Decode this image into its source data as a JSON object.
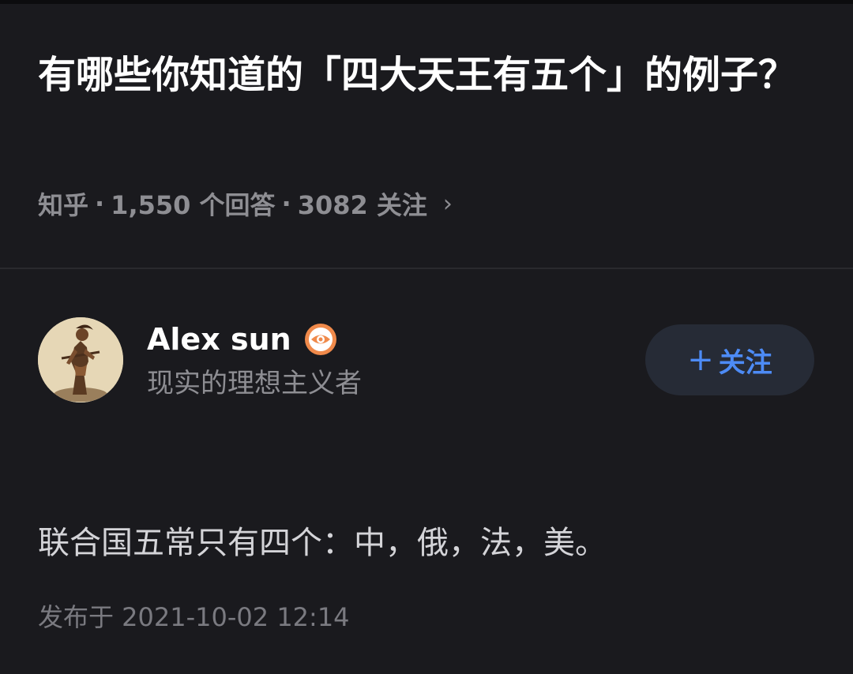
{
  "question": {
    "title": "有哪些你知道的「四大天王有五个」的例子？",
    "source": "知乎",
    "separator": "·",
    "answers": "1,550 个回答",
    "followers": "3082 关注",
    "chevron_icon": "chevron-right-icon"
  },
  "author": {
    "name": "Alex sun",
    "bio": "现实的理想主义者",
    "badge_icon": "eye-badge-icon",
    "avatar_icon": "warrior-avatar"
  },
  "follow_button": {
    "plus": "+",
    "label": "关注",
    "color": "#4d8bf5"
  },
  "answer": {
    "content": "联合国五常只有四个：中，俄，法，美。",
    "published": "发布于 2021-10-02 12:14"
  },
  "colors": {
    "background": "#1a1a1e",
    "accent": "#4d8bf5",
    "badge": "#f08a4b"
  }
}
